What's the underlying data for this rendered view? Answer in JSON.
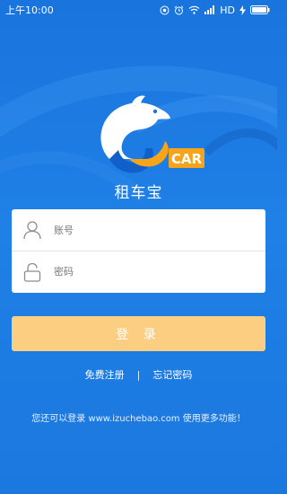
{
  "status_bar": {
    "time": "上午10:00",
    "carrier": "HD",
    "icons": [
      "sync-icon",
      "alarm-icon",
      "wifi-icon",
      "signal-icon",
      "charging-icon",
      "battery-icon"
    ]
  },
  "logo": {
    "badge_text": "CAR"
  },
  "app_name": "租车宝",
  "form": {
    "account_placeholder": "账号",
    "password_placeholder": "密码"
  },
  "login_button": "登 录",
  "links": {
    "register": "免费注册",
    "separator": "|",
    "forgot": "忘记密码"
  },
  "footer_note": "您还可以登录 www.izuchebao.com 使用更多功能！",
  "colors": {
    "background": "#1f80e6",
    "login_button": "#fcce82",
    "logo_orange": "#f6a51b"
  }
}
